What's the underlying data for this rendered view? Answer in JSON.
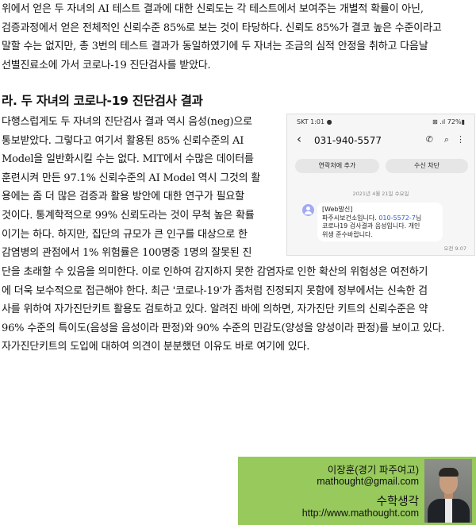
{
  "article": {
    "para1": [
      "위에서 얻은 두 자녀의 AI 테스트 결과에 대한 신뢰도는 각 테스트에서 보여주는 개별적 확률이 아닌,",
      "검증과정에서 얻은 전체적인 신뢰수준 85%로 보는 것이 타당하다. 신뢰도 85%가 결코 높은 수준이라고",
      "말할 수는 없지만, 총 3번의 테스트 결과가 동일하였기에 두 자녀는 조금의 심적 안정을 취하고 다음날",
      "선별진료소에 가서 코로나-19 진단검사를 받았다."
    ],
    "heading": "라. 두 자녀의 코로나-19 진단검사 결과",
    "para2": [
      "다행스럽게도 두 자녀의 진단검사 결과 역시 음성(neg)으로",
      "통보받았다. 그렇다고 여기서 활용된 85% 신뢰수준의 AI",
      "Model을 일반화시킬 수는 없다. MIT에서 수많은 데이터를",
      "훈련시켜 만든 97.1% 신뢰수준의 AI Model 역시 그것의 활",
      "용에는 좀 더 많은 검증과 활용 방안에 대한 연구가 필요할",
      "것이다. 통계학적으로 99% 신뢰도라는 것이 무척 높은 확률",
      "이기는 하다. 하지만, 집단의 규모가 큰 인구를 대상으로 한",
      "감염병의 관점에서 1% 위험률은 100명중 1명의 잘못된 진"
    ],
    "para3": [
      "단을 초래할 수 있음을 의미한다. 이로 인하여 감지하지 못한 감염자로 인한 확산의 위험성은 여전하기",
      "에 더욱 보수적으로 접근해야 한다. 최근 '코로나-19'가 좀처럼 진정되지 못함에 정부에서는 신속한 검",
      "사를 위하여 자가진단키트 활용도 검토하고 있다. 알려진 바에 의하면, 자가진단 키트의 신뢰수준은 약",
      "96% 수준의 특이도(음성을 음성이라 판정)와 90% 수준의 민감도(양성을 양성이라 판정)를 보이고 있다.",
      "자가진단키트의 도입에 대하여 의견이 분분했던 이유도 바로 여기에 있다."
    ]
  },
  "phone": {
    "status_carrier": "SKT 1:01 ●",
    "status_battery": "⊠ .ıl 72%▮",
    "back_icon": "‹",
    "number": "031-940-5577",
    "icons": {
      "call": "call-icon",
      "search": "search-icon",
      "more": "more-icon"
    },
    "call_glyph": "✆",
    "search_glyph": "⌕",
    "more_glyph": "⋮",
    "add_contact": "연락처에 추가",
    "block": "수신 차단",
    "date": "2021년 4월 21일 수요일",
    "message": {
      "line1": "[Web발신]",
      "line2_prefix": "파주시보건소입니다. ",
      "line2_link": "010-5572-7",
      "line2_suffix": "님",
      "line3": "코로나19 검사결과 음성입니다. 개인",
      "line4": "위생 준수바랍니다."
    },
    "time": "오전 9:07"
  },
  "author": {
    "name": "이장훈(경기 파주여고)",
    "email": "mathought@gmail.com",
    "site_name": "수학생각",
    "site_url": "http://www.mathought.com",
    "box_color": "#97c95c"
  }
}
